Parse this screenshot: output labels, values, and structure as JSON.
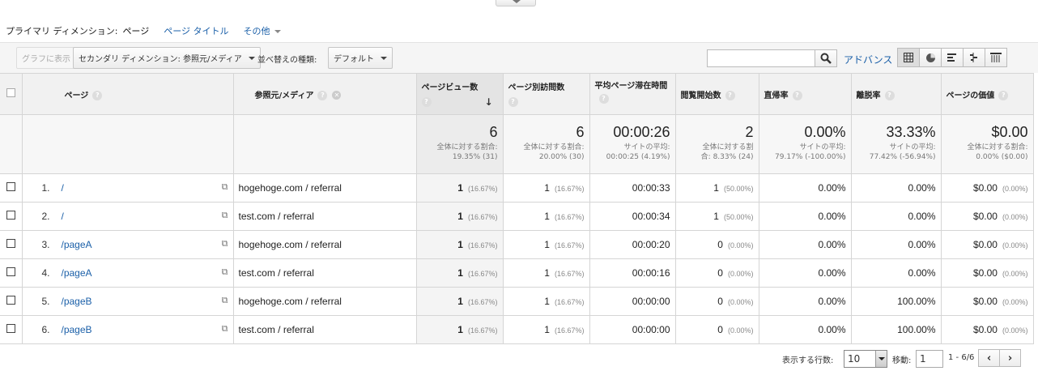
{
  "dimension_bar": {
    "label": "プライマリ ディメンション:",
    "active": "ページ",
    "link": "ページ タイトル",
    "more": "その他"
  },
  "toolbar": {
    "graph_button": "グラフに表示",
    "secondary_dimension": "セカンダリ ディメンション: 参照元/メディア",
    "sort_label": "並べ替えの種類:",
    "sort_value": "デフォルト",
    "search_placeholder": "",
    "advanced_link": "アドバンス"
  },
  "columns": {
    "page": "ページ",
    "source": "参照元/メディア",
    "pageviews": "ページビュー数",
    "unique": "ページ別訪問数",
    "avgtime": "平均ページ滞在時間",
    "entrances": "閲覧開始数",
    "bounce": "直帰率",
    "exit": "離脱率",
    "value": "ページの価値"
  },
  "summary": {
    "pageviews": {
      "value": "6",
      "sub": "全体に対する割合:",
      "sub2": "19.35% (31)"
    },
    "unique": {
      "value": "6",
      "sub": "全体に対する割合:",
      "sub2": "20.00% (30)"
    },
    "avgtime": {
      "value": "00:00:26",
      "sub": "サイトの平均:",
      "sub2": "00:00:25 (4.19%)"
    },
    "entrances": {
      "value": "2",
      "sub": "全体に対する割",
      "sub2": "合: 8.33% (24)"
    },
    "bounce": {
      "value": "0.00%",
      "sub": "サイトの平均:",
      "sub2": "79.17% (-100.00%)"
    },
    "exit": {
      "value": "33.33%",
      "sub": "サイトの平均:",
      "sub2": "77.42% (-56.94%)"
    },
    "value": {
      "value": "$0.00",
      "sub": "全体に対する割合:",
      "sub2": "0.00% ($0.00)"
    }
  },
  "rows": [
    {
      "n": "1.",
      "page": "/",
      "source": "hogehoge.com / referral",
      "pv": "1",
      "pv_pct": "(16.67%)",
      "uv": "1",
      "uv_pct": "(16.67%)",
      "time": "00:00:33",
      "ent": "1",
      "ent_pct": "(50.00%)",
      "bounce": "0.00%",
      "exit": "0.00%",
      "val": "$0.00",
      "val_pct": "(0.00%)"
    },
    {
      "n": "2.",
      "page": "/",
      "source": "test.com / referral",
      "pv": "1",
      "pv_pct": "(16.67%)",
      "uv": "1",
      "uv_pct": "(16.67%)",
      "time": "00:00:34",
      "ent": "1",
      "ent_pct": "(50.00%)",
      "bounce": "0.00%",
      "exit": "0.00%",
      "val": "$0.00",
      "val_pct": "(0.00%)"
    },
    {
      "n": "3.",
      "page": "/pageA",
      "source": "hogehoge.com / referral",
      "pv": "1",
      "pv_pct": "(16.67%)",
      "uv": "1",
      "uv_pct": "(16.67%)",
      "time": "00:00:20",
      "ent": "0",
      "ent_pct": "(0.00%)",
      "bounce": "0.00%",
      "exit": "0.00%",
      "val": "$0.00",
      "val_pct": "(0.00%)"
    },
    {
      "n": "4.",
      "page": "/pageA",
      "source": "test.com / referral",
      "pv": "1",
      "pv_pct": "(16.67%)",
      "uv": "1",
      "uv_pct": "(16.67%)",
      "time": "00:00:16",
      "ent": "0",
      "ent_pct": "(0.00%)",
      "bounce": "0.00%",
      "exit": "0.00%",
      "val": "$0.00",
      "val_pct": "(0.00%)"
    },
    {
      "n": "5.",
      "page": "/pageB",
      "source": "hogehoge.com / referral",
      "pv": "1",
      "pv_pct": "(16.67%)",
      "uv": "1",
      "uv_pct": "(16.67%)",
      "time": "00:00:00",
      "ent": "0",
      "ent_pct": "(0.00%)",
      "bounce": "0.00%",
      "exit": "100.00%",
      "val": "$0.00",
      "val_pct": "(0.00%)"
    },
    {
      "n": "6.",
      "page": "/pageB",
      "source": "test.com / referral",
      "pv": "1",
      "pv_pct": "(16.67%)",
      "uv": "1",
      "uv_pct": "(16.67%)",
      "time": "00:00:00",
      "ent": "0",
      "ent_pct": "(0.00%)",
      "bounce": "0.00%",
      "exit": "100.00%",
      "val": "$0.00",
      "val_pct": "(0.00%)"
    }
  ],
  "footer": {
    "rows_label": "表示する行数:",
    "rows_value": "10",
    "goto_label": "移動:",
    "goto_value": "1",
    "range": "1 - 6/6",
    "prev": "‹",
    "next": "›"
  },
  "colors": {
    "link": "#1a5fa8",
    "header_bg": "#f1f1f1",
    "sorted_bg": "#e4e4e4"
  }
}
